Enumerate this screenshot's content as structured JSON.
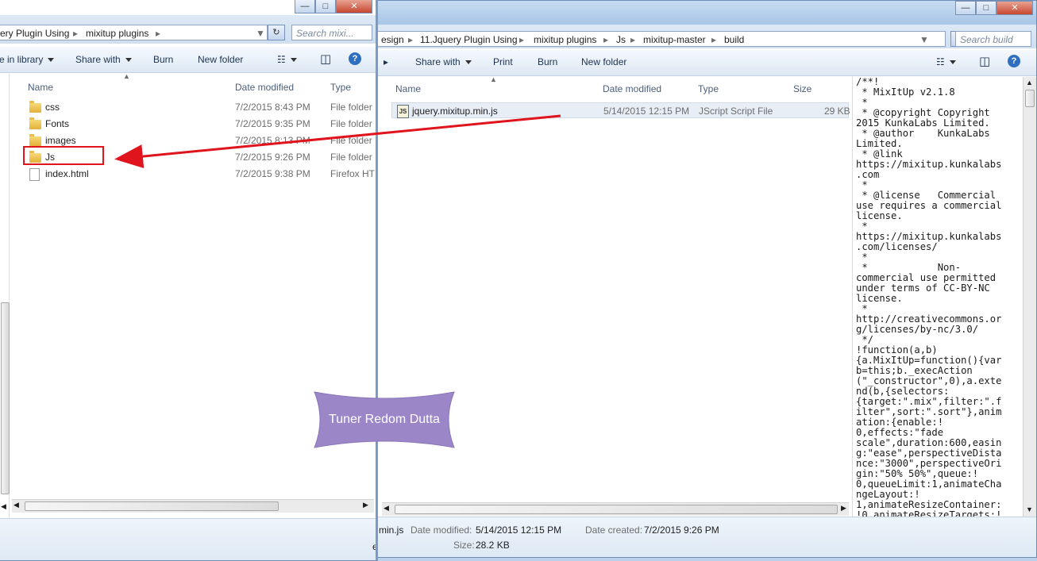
{
  "left_window": {
    "address": {
      "segments": [
        "ery Plugin Using",
        "mixitup plugins"
      ]
    },
    "search_placeholder": "Search mixi...",
    "toolbar": {
      "library": "e in library",
      "share": "Share with",
      "burn": "Burn",
      "new_folder": "New folder"
    },
    "columns": {
      "name": "Name",
      "date": "Date modified",
      "type": "Type"
    },
    "files": [
      {
        "name": "css",
        "date": "7/2/2015 8:43 PM",
        "type": "File folder"
      },
      {
        "name": "Fonts",
        "date": "7/2/2015 9:35 PM",
        "type": "File folder"
      },
      {
        "name": "images",
        "date": "7/2/2015 8:13 PM",
        "type": "File folder"
      },
      {
        "name": "Js",
        "date": "7/2/2015 9:26 PM",
        "type": "File folder"
      },
      {
        "name": "index.html",
        "date": "7/2/2015 9:38 PM",
        "type": "Firefox HT"
      }
    ],
    "statusbar": {
      "partial": "e"
    }
  },
  "right_window": {
    "address": {
      "segments": [
        "esign",
        "11.Jquery Plugin Using",
        "mixitup plugins",
        "Js",
        "mixitup-master",
        "build"
      ]
    },
    "search_placeholder": "Search build",
    "toolbar": {
      "share": "Share with",
      "print": "Print",
      "burn": "Burn",
      "new_folder": "New folder"
    },
    "columns": {
      "name": "Name",
      "date": "Date modified",
      "type": "Type",
      "size": "Size"
    },
    "files": [
      {
        "name": "jquery.mixitup.min.js",
        "date": "5/14/2015 12:15 PM",
        "type": "JScript Script File",
        "size": "29 KB"
      }
    ],
    "preview_lines": [
      "/**!",
      " * MixItUp v2.1.8",
      " *",
      " * @copyright Copyright",
      "2015 KunkaLabs Limited.",
      " * @author    KunkaLabs",
      "Limited.",
      " * @link",
      "https://mixitup.kunkalabs",
      ".com",
      " *",
      " * @license   Commercial",
      "use requires a commercial",
      "license.",
      " *",
      "https://mixitup.kunkalabs",
      ".com/licenses/",
      " *",
      " *            Non-",
      "commercial use permitted",
      "under terms of CC-BY-NC",
      "license.",
      " *",
      "http://creativecommons.or",
      "g/licenses/by-nc/3.0/",
      " */",
      "!function(a,b)",
      "{a.MixItUp=function(){var",
      "b=this;b._execAction",
      "(\"_constructor\",0),a.exte",
      "nd(b,{selectors:",
      "{target:\".mix\",filter:\".f",
      "ilter\",sort:\".sort\"},anim",
      "ation:{enable:!",
      "0,effects:\"fade",
      "scale\",duration:600,easin",
      "g:\"ease\",perspectiveDista",
      "nce:\"3000\",perspectiveOri",
      "gin:\"50% 50%\",queue:!",
      "0,queueLimit:1,animateCha",
      "ngeLayout:!",
      "1,animateResizeContainer:",
      "!0,animateResizeTargets:!"
    ],
    "details": {
      "name_partial": "min.js",
      "date_modified_label": "Date modified:",
      "date_modified": "5/14/2015 12:15 PM",
      "date_created_label": "Date created:",
      "date_created": "7/2/2015 9:26 PM",
      "size_label": "Size:",
      "size": "28.2 KB"
    }
  },
  "watermark": {
    "text": "Tuner Redom Dutta"
  },
  "colors": {
    "arrow": "#e0141c",
    "watermark": "#9b86c8",
    "highlight_box": "#e0141c"
  }
}
